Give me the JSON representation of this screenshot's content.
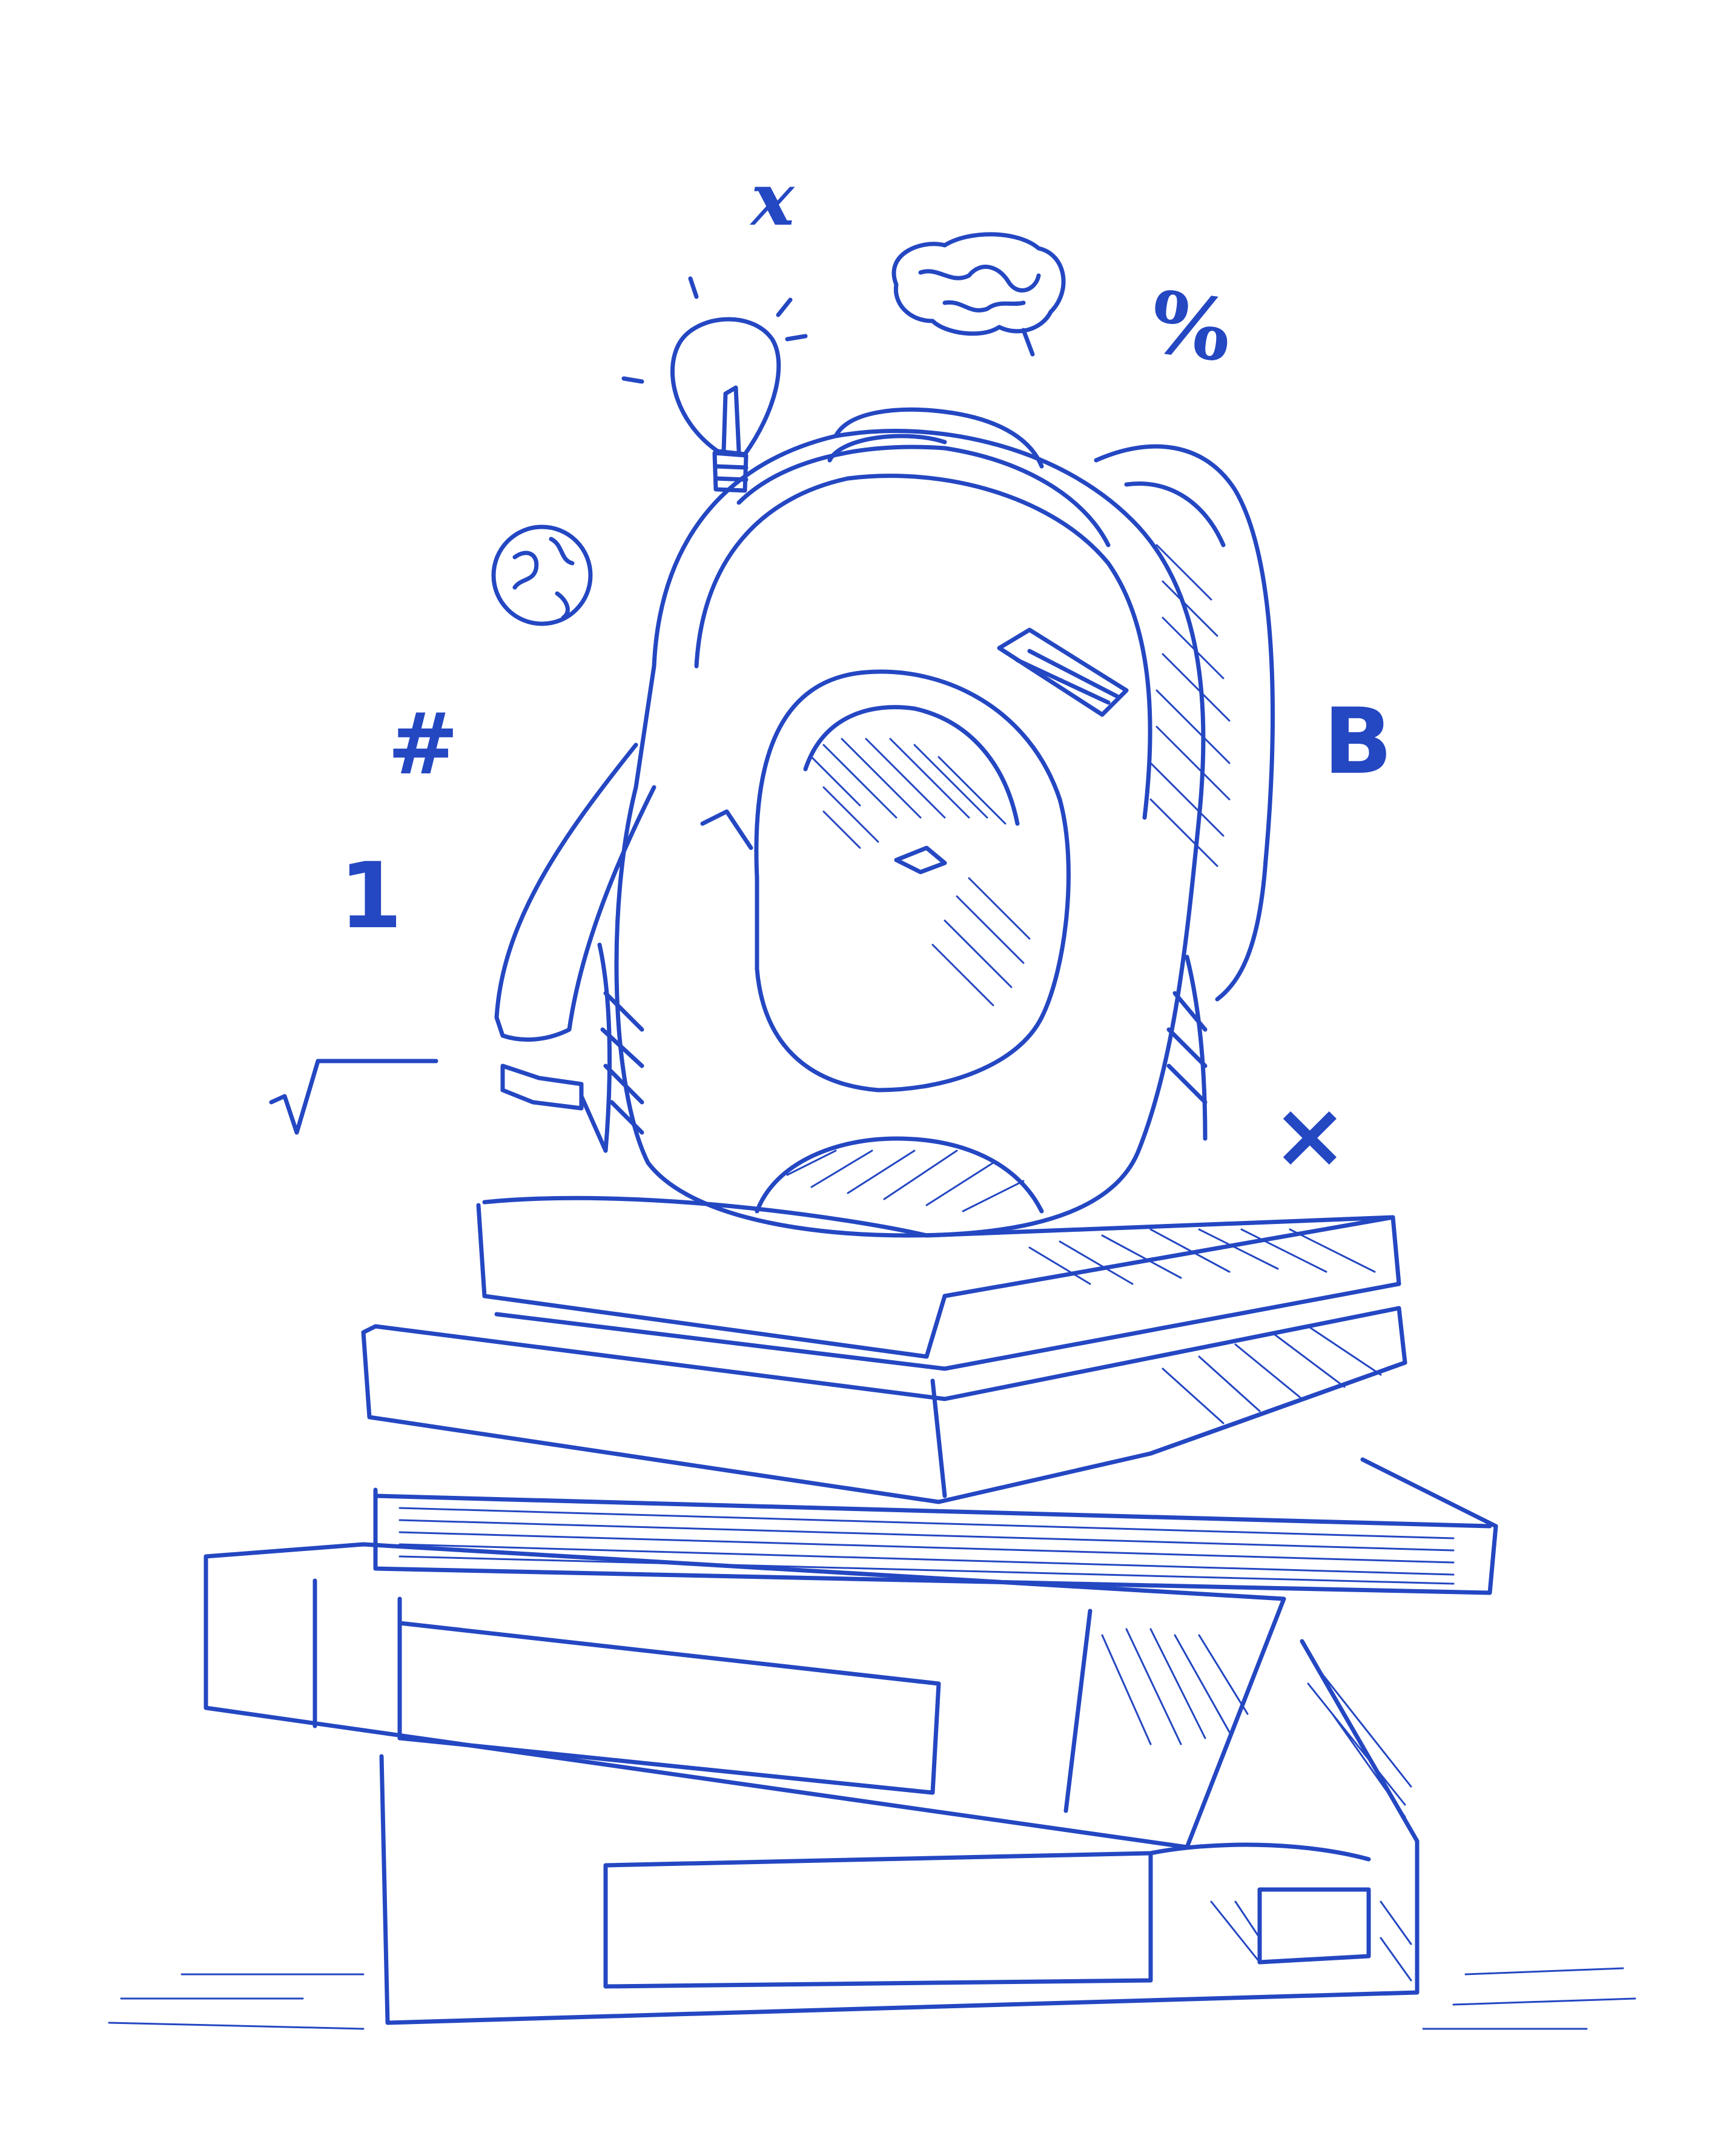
{
  "colors": {
    "ink": "#2447c2",
    "background": "#ffffff"
  },
  "doodles": {
    "variable_x": "x",
    "percent": "%",
    "hash": "#",
    "letter_b": "B",
    "number_one": "1",
    "multiply": "×"
  },
  "icons": [
    "lightbulb-icon",
    "brain-icon",
    "globe-icon",
    "square-root-icon"
  ]
}
